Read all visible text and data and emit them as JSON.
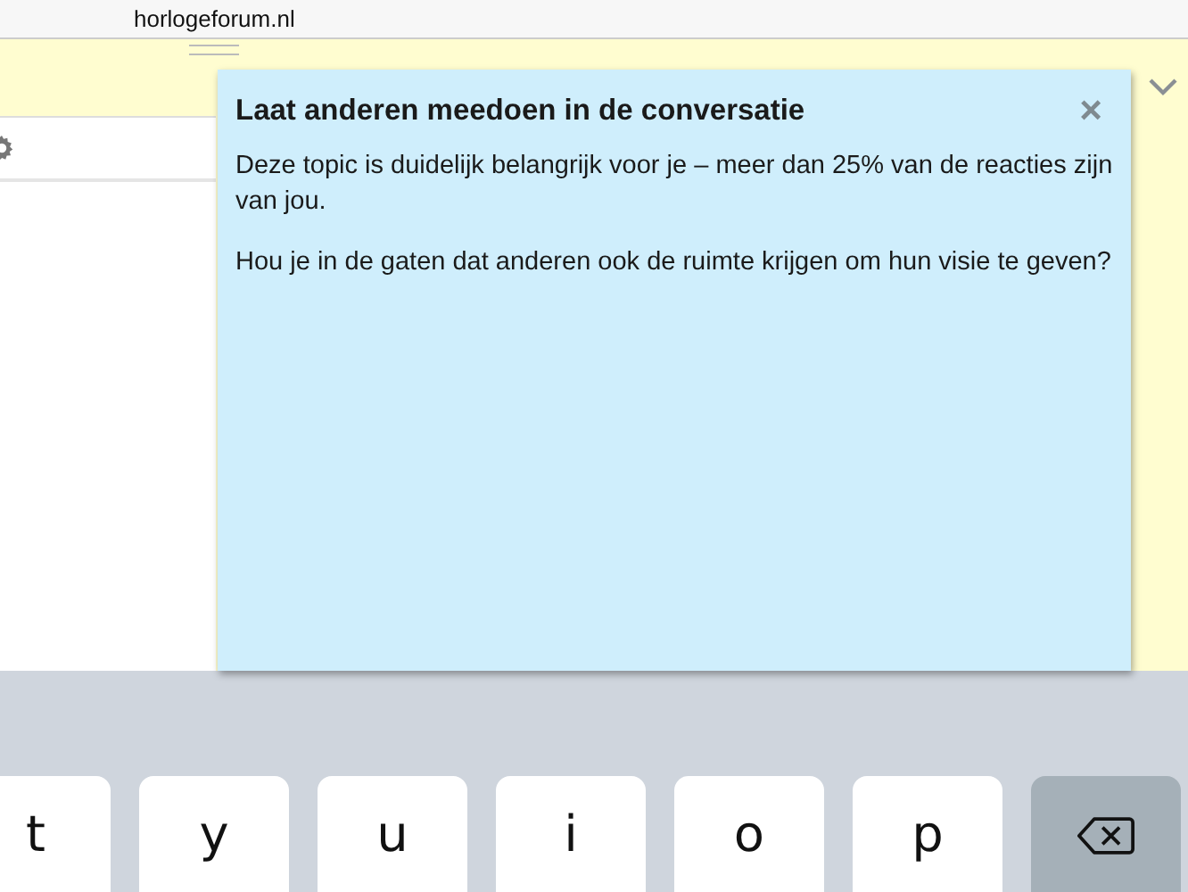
{
  "address_bar": {
    "url": "horlogeforum.nl"
  },
  "popup": {
    "title": "Laat anderen meedoen in de conversatie",
    "close": "×",
    "paragraphs": [
      "Deze topic is duidelijk belangrijk voor je – meer dan 25% van de reacties zijn van jou.",
      "Hou je in de gaten dat anderen ook de ruimte krijgen om hun visie te geven?"
    ]
  },
  "keyboard": {
    "keys": [
      {
        "kind": "letter",
        "label": "t"
      },
      {
        "kind": "letter",
        "label": "y"
      },
      {
        "kind": "letter",
        "label": "u"
      },
      {
        "kind": "letter",
        "label": "i"
      },
      {
        "kind": "letter",
        "label": "o"
      },
      {
        "kind": "letter",
        "label": "p"
      },
      {
        "kind": "backspace"
      }
    ]
  }
}
